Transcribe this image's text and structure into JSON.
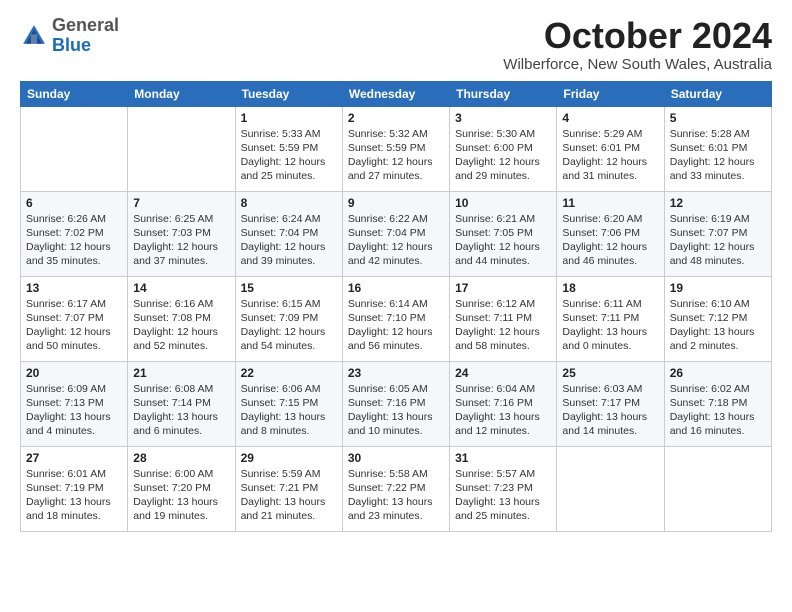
{
  "header": {
    "logo_line1": "General",
    "logo_line2": "Blue",
    "month": "October 2024",
    "location": "Wilberforce, New South Wales, Australia"
  },
  "days_of_week": [
    "Sunday",
    "Monday",
    "Tuesday",
    "Wednesday",
    "Thursday",
    "Friday",
    "Saturday"
  ],
  "weeks": [
    [
      {
        "day": "",
        "info": ""
      },
      {
        "day": "",
        "info": ""
      },
      {
        "day": "1",
        "info": "Sunrise: 5:33 AM\nSunset: 5:59 PM\nDaylight: 12 hours\nand 25 minutes."
      },
      {
        "day": "2",
        "info": "Sunrise: 5:32 AM\nSunset: 5:59 PM\nDaylight: 12 hours\nand 27 minutes."
      },
      {
        "day": "3",
        "info": "Sunrise: 5:30 AM\nSunset: 6:00 PM\nDaylight: 12 hours\nand 29 minutes."
      },
      {
        "day": "4",
        "info": "Sunrise: 5:29 AM\nSunset: 6:01 PM\nDaylight: 12 hours\nand 31 minutes."
      },
      {
        "day": "5",
        "info": "Sunrise: 5:28 AM\nSunset: 6:01 PM\nDaylight: 12 hours\nand 33 minutes."
      }
    ],
    [
      {
        "day": "6",
        "info": "Sunrise: 6:26 AM\nSunset: 7:02 PM\nDaylight: 12 hours\nand 35 minutes."
      },
      {
        "day": "7",
        "info": "Sunrise: 6:25 AM\nSunset: 7:03 PM\nDaylight: 12 hours\nand 37 minutes."
      },
      {
        "day": "8",
        "info": "Sunrise: 6:24 AM\nSunset: 7:04 PM\nDaylight: 12 hours\nand 39 minutes."
      },
      {
        "day": "9",
        "info": "Sunrise: 6:22 AM\nSunset: 7:04 PM\nDaylight: 12 hours\nand 42 minutes."
      },
      {
        "day": "10",
        "info": "Sunrise: 6:21 AM\nSunset: 7:05 PM\nDaylight: 12 hours\nand 44 minutes."
      },
      {
        "day": "11",
        "info": "Sunrise: 6:20 AM\nSunset: 7:06 PM\nDaylight: 12 hours\nand 46 minutes."
      },
      {
        "day": "12",
        "info": "Sunrise: 6:19 AM\nSunset: 7:07 PM\nDaylight: 12 hours\nand 48 minutes."
      }
    ],
    [
      {
        "day": "13",
        "info": "Sunrise: 6:17 AM\nSunset: 7:07 PM\nDaylight: 12 hours\nand 50 minutes."
      },
      {
        "day": "14",
        "info": "Sunrise: 6:16 AM\nSunset: 7:08 PM\nDaylight: 12 hours\nand 52 minutes."
      },
      {
        "day": "15",
        "info": "Sunrise: 6:15 AM\nSunset: 7:09 PM\nDaylight: 12 hours\nand 54 minutes."
      },
      {
        "day": "16",
        "info": "Sunrise: 6:14 AM\nSunset: 7:10 PM\nDaylight: 12 hours\nand 56 minutes."
      },
      {
        "day": "17",
        "info": "Sunrise: 6:12 AM\nSunset: 7:11 PM\nDaylight: 12 hours\nand 58 minutes."
      },
      {
        "day": "18",
        "info": "Sunrise: 6:11 AM\nSunset: 7:11 PM\nDaylight: 13 hours\nand 0 minutes."
      },
      {
        "day": "19",
        "info": "Sunrise: 6:10 AM\nSunset: 7:12 PM\nDaylight: 13 hours\nand 2 minutes."
      }
    ],
    [
      {
        "day": "20",
        "info": "Sunrise: 6:09 AM\nSunset: 7:13 PM\nDaylight: 13 hours\nand 4 minutes."
      },
      {
        "day": "21",
        "info": "Sunrise: 6:08 AM\nSunset: 7:14 PM\nDaylight: 13 hours\nand 6 minutes."
      },
      {
        "day": "22",
        "info": "Sunrise: 6:06 AM\nSunset: 7:15 PM\nDaylight: 13 hours\nand 8 minutes."
      },
      {
        "day": "23",
        "info": "Sunrise: 6:05 AM\nSunset: 7:16 PM\nDaylight: 13 hours\nand 10 minutes."
      },
      {
        "day": "24",
        "info": "Sunrise: 6:04 AM\nSunset: 7:16 PM\nDaylight: 13 hours\nand 12 minutes."
      },
      {
        "day": "25",
        "info": "Sunrise: 6:03 AM\nSunset: 7:17 PM\nDaylight: 13 hours\nand 14 minutes."
      },
      {
        "day": "26",
        "info": "Sunrise: 6:02 AM\nSunset: 7:18 PM\nDaylight: 13 hours\nand 16 minutes."
      }
    ],
    [
      {
        "day": "27",
        "info": "Sunrise: 6:01 AM\nSunset: 7:19 PM\nDaylight: 13 hours\nand 18 minutes."
      },
      {
        "day": "28",
        "info": "Sunrise: 6:00 AM\nSunset: 7:20 PM\nDaylight: 13 hours\nand 19 minutes."
      },
      {
        "day": "29",
        "info": "Sunrise: 5:59 AM\nSunset: 7:21 PM\nDaylight: 13 hours\nand 21 minutes."
      },
      {
        "day": "30",
        "info": "Sunrise: 5:58 AM\nSunset: 7:22 PM\nDaylight: 13 hours\nand 23 minutes."
      },
      {
        "day": "31",
        "info": "Sunrise: 5:57 AM\nSunset: 7:23 PM\nDaylight: 13 hours\nand 25 minutes."
      },
      {
        "day": "",
        "info": ""
      },
      {
        "day": "",
        "info": ""
      }
    ]
  ]
}
